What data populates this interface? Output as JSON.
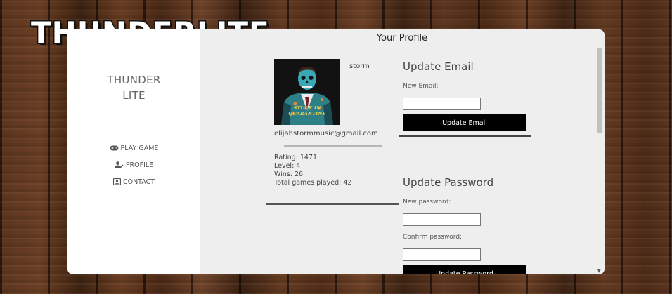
{
  "logo": {
    "text": "THUNDERLITE"
  },
  "panel": {
    "title": "Your Profile"
  },
  "sidebar": {
    "brand_line1": "THUNDER",
    "brand_line2": "LITE",
    "nav": [
      {
        "label": "PLAY GAME",
        "icon": "gamepad-icon"
      },
      {
        "label": "PROFILE",
        "icon": "user-edit-icon"
      },
      {
        "label": "CONTACT",
        "icon": "contact-card-icon"
      }
    ]
  },
  "profile": {
    "username": "storm",
    "avatar_caption": "STUCK IN QUARANTINE",
    "email": "elijahstormmusic@gmail.com",
    "stats": {
      "rating": "Rating: 1471",
      "level": "Level: 4",
      "wins": "Wins: 26",
      "total": "Total games played: 42"
    }
  },
  "update_email": {
    "title": "Update Email",
    "label": "New Email:",
    "value": "",
    "button": "Update Email"
  },
  "update_password": {
    "title": "Update Password",
    "new_label": "New password:",
    "new_value": "",
    "confirm_label": "Confirm password:",
    "confirm_value": "",
    "button": "Update Password"
  },
  "colors": {
    "panel_bg": "#ffffff",
    "main_bg": "#eeeeee",
    "button_bg": "#000000",
    "button_text": "#ffffff"
  }
}
